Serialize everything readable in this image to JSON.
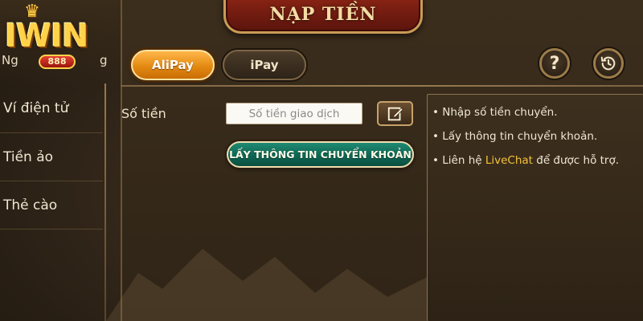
{
  "logo": {
    "text": "IWIN",
    "badge": "888",
    "sub_left": "Ng",
    "sub_right": "g"
  },
  "title": "NẠP TIỀN",
  "tabs": [
    {
      "label": "AliPay",
      "active": true
    },
    {
      "label": "iPay",
      "active": false
    }
  ],
  "header_buttons": {
    "help_label": "?",
    "help_icon": "question-icon",
    "history_icon": "history-clock-icon"
  },
  "sidebar": {
    "items": [
      {
        "label": "Ví điện tử"
      },
      {
        "label": "Tiền ảo"
      },
      {
        "label": "Thẻ cào"
      }
    ]
  },
  "form": {
    "amount_label": "Số tiền",
    "amount_placeholder": "Số tiền giao dịch",
    "amount_value": "",
    "edit_icon": "edit-pencil-icon",
    "submit_label": "LẤY THÔNG TIN CHUYỂN KHOẢN"
  },
  "instructions": {
    "line1": "Nhập số tiền chuyển.",
    "line2": "Lấy thông tin chuyển khoản.",
    "line3_prefix": "Liên hệ ",
    "line3_highlight": "LiveChat",
    "line3_suffix": " để được hỗ trợ.",
    "bullet": "•"
  },
  "colors": {
    "accent_orange": "#e38a12",
    "cta_green": "#0f6653",
    "title_red": "#8a2415",
    "highlight_yellow": "#f5c33a"
  }
}
